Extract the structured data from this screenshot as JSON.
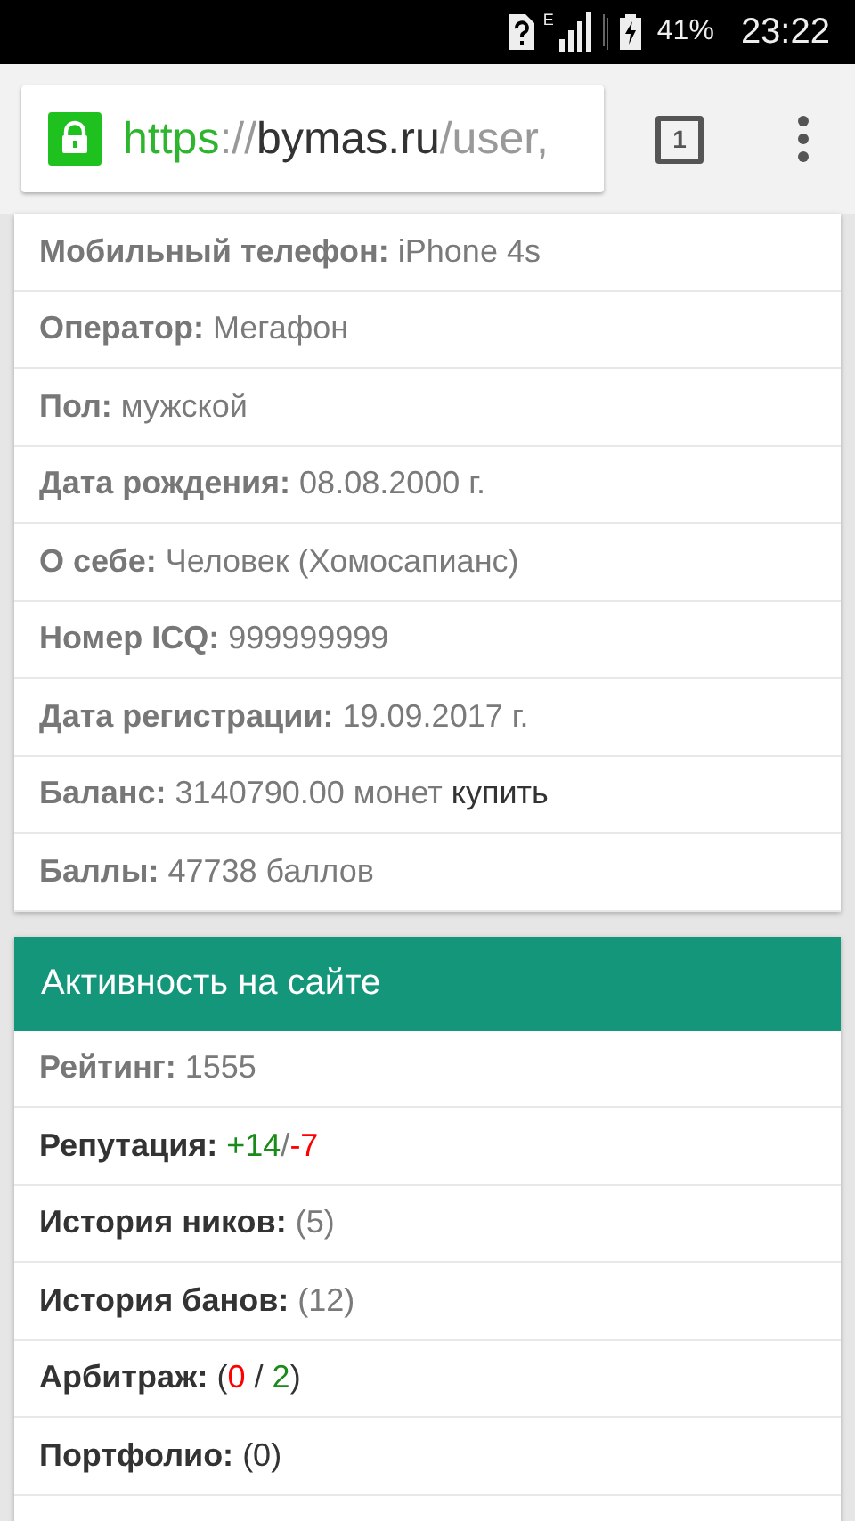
{
  "status_bar": {
    "network": "E",
    "battery": "41%",
    "time": "23:22"
  },
  "browser": {
    "url_scheme": "https",
    "url_sep": "://",
    "url_host": "bymas.ru",
    "url_path": "/user,",
    "tab_count": "1"
  },
  "profile_rows": [
    {
      "label": "Мобильный телефон:",
      "parts": [
        {
          "text": "iPhone 4s",
          "color": "#7a7a7a"
        }
      ]
    },
    {
      "label": "Оператор:",
      "parts": [
        {
          "text": "Мегафон",
          "color": "#7a7a7a"
        }
      ]
    },
    {
      "label": "Пол:",
      "parts": [
        {
          "text": "мужской",
          "color": "#7a7a7a"
        }
      ]
    },
    {
      "label": "Дата рождения:",
      "parts": [
        {
          "text": "08.08.2000 г.",
          "color": "#7a7a7a"
        }
      ]
    },
    {
      "label": "О себе:",
      "parts": [
        {
          "text": "Человек (Хомосапианс)",
          "color": "#7a7a7a"
        }
      ]
    },
    {
      "label": "Номер ICQ:",
      "parts": [
        {
          "text": "999999999",
          "color": "#7a7a7a"
        }
      ]
    },
    {
      "label": "Дата регистрации:",
      "parts": [
        {
          "text": "19.09.2017 г.",
          "color": "#7a7a7a"
        }
      ]
    },
    {
      "label": "Баланс:",
      "parts": [
        {
          "text": "3140790.00 монет",
          "color": "#7a7a7a"
        }
      ],
      "link": "купить"
    },
    {
      "label": "Баллы:",
      "parts": [
        {
          "text": "47738 баллов",
          "color": "#7a7a7a"
        }
      ]
    }
  ],
  "activity": {
    "title": "Активность на сайте",
    "rows": [
      {
        "label": "Рейтинг:",
        "kind": "info",
        "parts": [
          {
            "text": "1555",
            "color": "#7a7a7a"
          }
        ]
      },
      {
        "label": "Репутация:",
        "kind": "link",
        "parts": [
          {
            "text": "+14",
            "color": "#1a8a1a"
          },
          {
            "text": "/",
            "color": "#7a7a7a"
          },
          {
            "text": "-7",
            "color": "#ff0000"
          }
        ]
      },
      {
        "label": "История ников:",
        "kind": "link",
        "parts": [
          {
            "text": "(5)",
            "color": "#7a7a7a"
          }
        ]
      },
      {
        "label": "История банов:",
        "kind": "link",
        "parts": [
          {
            "text": "(12)",
            "color": "#7a7a7a"
          }
        ]
      },
      {
        "label": "Арбитраж:",
        "kind": "link",
        "parts": [
          {
            "text": "(",
            "color": "#333333"
          },
          {
            "text": "0",
            "color": "#ff0000"
          },
          {
            "text": " / ",
            "color": "#333333"
          },
          {
            "text": "2",
            "color": "#1a8a1a"
          },
          {
            "text": ")",
            "color": "#333333"
          }
        ]
      },
      {
        "label": "Портфолио:",
        "kind": "link",
        "parts": [
          {
            "text": "(0)",
            "color": "#333333"
          }
        ]
      }
    ]
  }
}
